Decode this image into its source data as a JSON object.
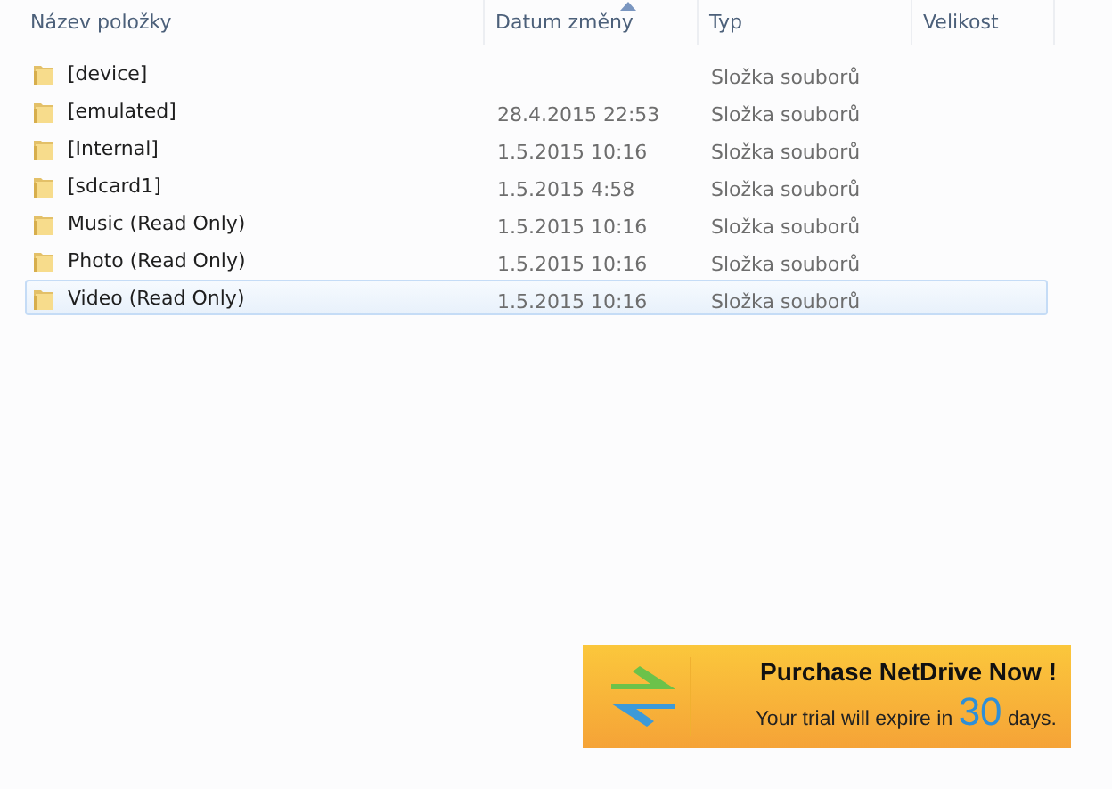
{
  "columns": [
    {
      "label": "Název položky",
      "sorted": false
    },
    {
      "label": "Datum změny",
      "sorted": true
    },
    {
      "label": "Typ",
      "sorted": false
    },
    {
      "label": "Velikost",
      "sorted": false
    }
  ],
  "rows": [
    {
      "name": "[device]",
      "date": "",
      "type": "Složka souborů",
      "selected": false
    },
    {
      "name": "[emulated]",
      "date": "28.4.2015 22:53",
      "type": "Složka souborů",
      "selected": false
    },
    {
      "name": "[Internal]",
      "date": "1.5.2015 10:16",
      "type": "Složka souborů",
      "selected": false
    },
    {
      "name": "[sdcard1]",
      "date": "1.5.2015 4:58",
      "type": "Složka souborů",
      "selected": false
    },
    {
      "name": "Music (Read Only)",
      "date": "1.5.2015 10:16",
      "type": "Složka souborů",
      "selected": false
    },
    {
      "name": "Photo (Read Only)",
      "date": "1.5.2015 10:16",
      "type": "Složka souborů",
      "selected": false
    },
    {
      "name": "Video (Read Only)",
      "date": "1.5.2015 10:16",
      "type": "Složka souborů",
      "selected": true
    }
  ],
  "banner": {
    "title": "Purchase NetDrive Now !",
    "trial_before": "Your trial will expire in",
    "trial_days": "30",
    "trial_after": "days."
  }
}
